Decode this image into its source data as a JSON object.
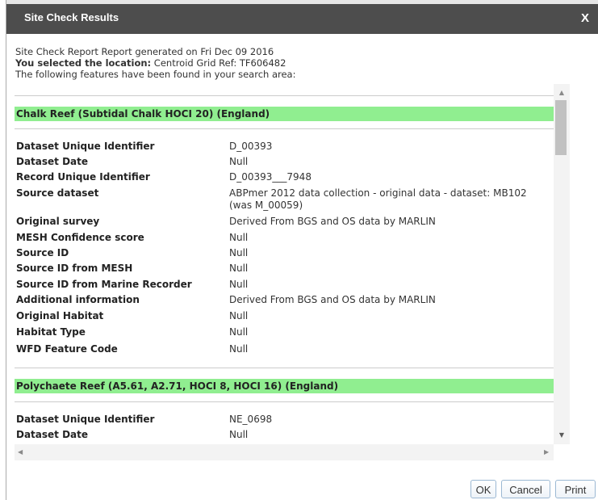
{
  "dialog": {
    "title": "Site Check Results",
    "close_label": "X"
  },
  "intro": {
    "line1": "Site Check Report Report generated on Fri Dec 09 2016",
    "selected_label": "You selected the location:",
    "selected_value": " Centroid Grid Ref: TF606482",
    "line3": "The following features have been found in your search area:"
  },
  "sections": [
    {
      "heading": "Chalk Reef (Subtidal Chalk HOCI 20) (England)",
      "rows": [
        {
          "key": "Dataset Unique Identifier",
          "value": "D_00393"
        },
        {
          "key": "Dataset Date",
          "value": "Null"
        },
        {
          "key": "Record Unique Identifier",
          "value": "D_00393___7948"
        },
        {
          "key": "Source dataset",
          "value": "ABPmer 2012 data collection - original data - dataset: MB102 (was M_00059)"
        },
        {
          "key": "Original survey",
          "value": "Derived From BGS and OS data by MARLIN"
        },
        {
          "key": "MESH Confidence score",
          "value": "Null"
        },
        {
          "key": "Source ID",
          "value": "Null"
        },
        {
          "key": "Source ID from MESH",
          "value": "Null"
        },
        {
          "key": "Source ID from Marine Recorder",
          "value": "Null"
        },
        {
          "key": "Additional information",
          "value": "Derived From BGS and OS data by MARLIN"
        },
        {
          "key": "Original Habitat",
          "value": "Null"
        },
        {
          "key": "Habitat Type",
          "value": "Null"
        },
        {
          "key": "WFD Feature Code",
          "value": "Null"
        }
      ]
    },
    {
      "heading": "Polychaete Reef (A5.61, A2.71, HOCI 8, HOCI 16) (England)",
      "rows": [
        {
          "key": "Dataset Unique Identifier",
          "value": "NE_0698"
        },
        {
          "key": "Dataset Date",
          "value": "Null"
        }
      ]
    }
  ],
  "buttons": {
    "ok": "OK",
    "cancel": "Cancel",
    "print": "Print"
  },
  "scrollbars": {
    "up_arrow": "▲",
    "down_arrow": "▼",
    "left_arrow": "◀",
    "right_arrow": "▶"
  }
}
